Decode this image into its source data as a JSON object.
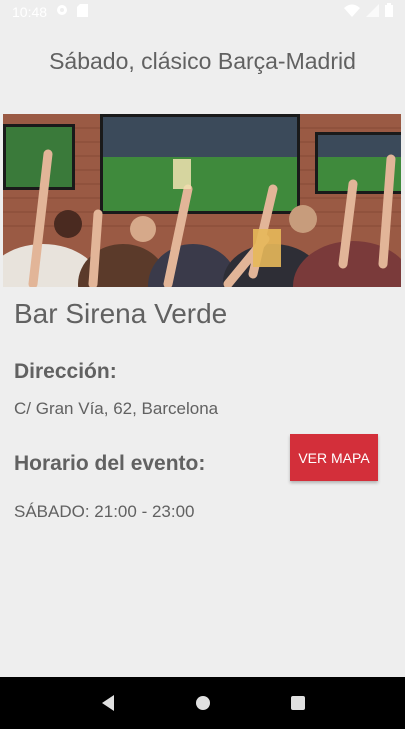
{
  "status": {
    "time": "10:48"
  },
  "header": {
    "title": "Sábado, clásico Barça-Madrid"
  },
  "venue": {
    "name": "Bar Sirena Verde",
    "address_label": "Dirección:",
    "address": "C/ Gran Vía, 62,  Barcelona",
    "schedule_label": "Horario del evento:",
    "schedule": "SÁBADO: 21:00 - 23:00",
    "map_button": "VER MAPA"
  },
  "colors": {
    "accent": "#d32f3a",
    "background": "#eeeeee",
    "text": "#616161"
  },
  "icons": [
    "gear-icon",
    "sd-card-icon",
    "wifi-icon",
    "signal-icon",
    "battery-icon",
    "back-icon",
    "home-icon",
    "recents-icon"
  ]
}
